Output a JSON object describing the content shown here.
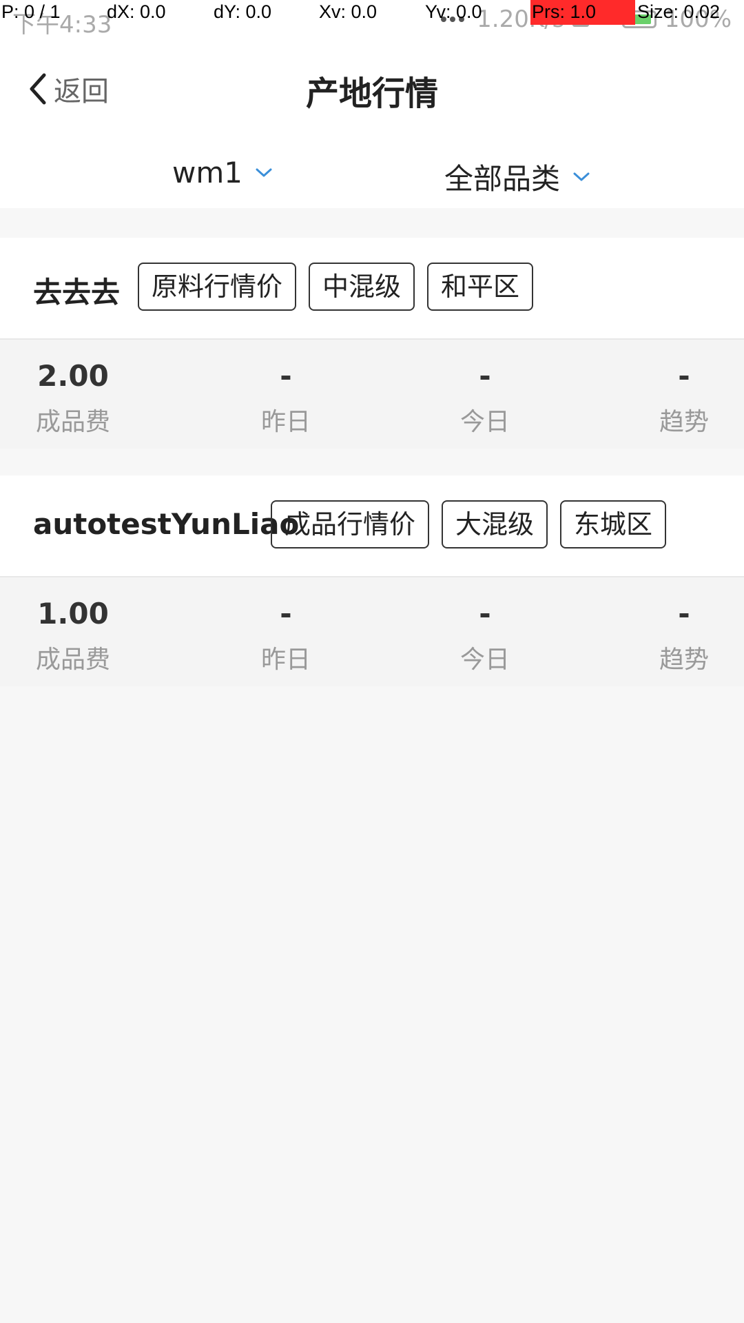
{
  "status_bar": {
    "time": "下午4:33",
    "net_speed": "1.20K/s",
    "battery": "100%"
  },
  "pointer_overlay": {
    "p": "P: 0 / 1",
    "dx": "dX: 0.0",
    "dy": "dY: 0.0",
    "xv": "Xv: 0.0",
    "yv": "Yv: 0.0",
    "prs": "Prs: 1.0",
    "size": "Size: 0.02"
  },
  "header": {
    "back_label": "返回",
    "title": "产地行情"
  },
  "filters": {
    "warehouse": "wm1",
    "category": "全部品类"
  },
  "cards": [
    {
      "name": "去去去",
      "tags": [
        "原料行情价",
        "中混级",
        "和平区"
      ],
      "stats": [
        {
          "value": "2.00",
          "label": "成品费"
        },
        {
          "value": "-",
          "label": "昨日"
        },
        {
          "value": "-",
          "label": "今日"
        },
        {
          "value": "-",
          "label": "趋势"
        }
      ]
    },
    {
      "name": "autotestYunLiao",
      "tags": [
        "成品行情价",
        "大混级",
        "东城区"
      ],
      "stats": [
        {
          "value": "1.00",
          "label": "成品费"
        },
        {
          "value": "-",
          "label": "昨日"
        },
        {
          "value": "-",
          "label": "今日"
        },
        {
          "value": "-",
          "label": "趋势"
        }
      ]
    }
  ],
  "colors": {
    "accent": "#3b8fd9",
    "prs_highlight": "#ff2a2a"
  },
  "icons": {
    "back": "chevron-left-icon",
    "dropdown": "chevron-down-icon"
  }
}
